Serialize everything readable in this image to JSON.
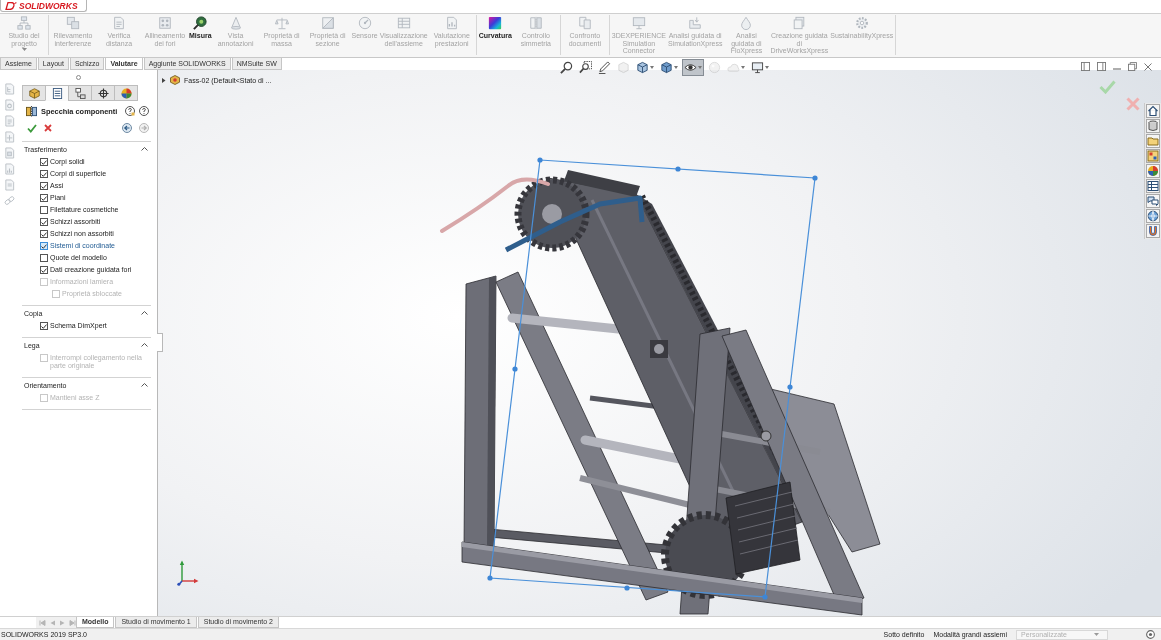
{
  "logo": {
    "text": "SOLIDWORKS"
  },
  "ribbon": {
    "groups": [
      {
        "buttons": [
          {
            "label": "Studio del progetto",
            "kind": "dropdown",
            "disabled": true
          }
        ]
      },
      {
        "buttons": [
          {
            "label": "Rilevamento interferenze",
            "kind": "button",
            "disabled": true
          },
          {
            "label": "Verifica distanza",
            "kind": "button",
            "disabled": true
          },
          {
            "label": "Allineamento dei fori",
            "kind": "button",
            "disabled": true
          },
          {
            "label": "Misura",
            "kind": "button",
            "disabled": false
          },
          {
            "label": "Vista annotazioni",
            "kind": "button",
            "disabled": true
          },
          {
            "label": "Proprietà di massa",
            "kind": "button",
            "disabled": true
          },
          {
            "label": "Proprietà di sezione",
            "kind": "button",
            "disabled": true
          },
          {
            "label": "Sensore",
            "kind": "button",
            "disabled": true
          },
          {
            "label": "Visualizzazione dell'assieme",
            "kind": "button",
            "disabled": true
          },
          {
            "label": "Valutazione prestazioni",
            "kind": "button",
            "disabled": true
          }
        ]
      },
      {
        "buttons": [
          {
            "label": "Curvatura",
            "kind": "button",
            "disabled": false
          },
          {
            "label": "Controllo simmetria",
            "kind": "button",
            "disabled": true
          }
        ]
      },
      {
        "buttons": [
          {
            "label": "Confronto documenti",
            "kind": "button",
            "disabled": true
          }
        ]
      },
      {
        "buttons": [
          {
            "label": "3DEXPERIENCE Simulation Connector",
            "kind": "button",
            "disabled": true
          },
          {
            "label": "Analisi guidata di SimulationXpress",
            "kind": "button",
            "disabled": true
          },
          {
            "label": "Analisi guidata di FloXpress",
            "kind": "button",
            "disabled": true
          },
          {
            "label": "Creazione guidata di DriveWorksXpress",
            "kind": "button",
            "disabled": true
          },
          {
            "label": "SustainabilityXpress",
            "kind": "button",
            "disabled": true
          }
        ]
      }
    ]
  },
  "command_tabs": [
    {
      "label": "Assieme",
      "selected": false
    },
    {
      "label": "Layout",
      "selected": false
    },
    {
      "label": "Schizzo",
      "selected": false
    },
    {
      "label": "Valutare",
      "selected": true
    },
    {
      "label": "Aggiunte SOLIDWORKS",
      "selected": false
    },
    {
      "label": "NMSuite SW",
      "selected": false
    }
  ],
  "property_manager": {
    "tabs": [
      {
        "selected": false
      },
      {
        "selected": true
      },
      {
        "selected": false
      },
      {
        "selected": false
      },
      {
        "selected": false
      }
    ],
    "title": "Specchia componenti",
    "sections": [
      {
        "title": "Trasferimento",
        "expanded": true,
        "options": [
          {
            "label": "Corpi solidi",
            "checked": true,
            "disabled": false,
            "highlighted": false
          },
          {
            "label": "Corpi di superficie",
            "checked": true,
            "disabled": false,
            "highlighted": false
          },
          {
            "label": "Assi",
            "checked": true,
            "disabled": false,
            "highlighted": false
          },
          {
            "label": "Piani",
            "checked": true,
            "disabled": false,
            "highlighted": false
          },
          {
            "label": "Filettature cosmetiche",
            "checked": false,
            "disabled": false,
            "highlighted": false
          },
          {
            "label": "Schizzi assorbiti",
            "checked": true,
            "disabled": false,
            "highlighted": false
          },
          {
            "label": "Schizzi non assorbiti",
            "checked": true,
            "disabled": false,
            "highlighted": false
          },
          {
            "label": "Sistemi di coordinate",
            "checked": true,
            "disabled": false,
            "highlighted": true
          },
          {
            "label": "Quote del modello",
            "checked": false,
            "disabled": false,
            "highlighted": false
          },
          {
            "label": "Dati creazione guidata fori",
            "checked": true,
            "disabled": false,
            "highlighted": false
          },
          {
            "label": "Informazioni lamiera",
            "checked": false,
            "disabled": true,
            "highlighted": false,
            "children": [
              {
                "label": "Proprietà sbloccate",
                "checked": false,
                "disabled": true,
                "highlighted": false
              }
            ]
          }
        ]
      },
      {
        "title": "Copia",
        "expanded": true,
        "options": [
          {
            "label": "Schema DimXpert",
            "checked": true,
            "disabled": false,
            "highlighted": false
          }
        ]
      },
      {
        "title": "Lega",
        "expanded": true,
        "options": [
          {
            "label": "Interrompi collegamento nella parte originale",
            "checked": false,
            "disabled": true,
            "highlighted": false
          }
        ]
      },
      {
        "title": "Orientamento",
        "expanded": true,
        "options": [
          {
            "label": "Mantieni asse Z",
            "checked": false,
            "disabled": true,
            "highlighted": false
          }
        ]
      }
    ]
  },
  "viewport": {
    "tree": {
      "label": "Fass-02 (Default<Stato di ...",
      "expanded": false
    },
    "view_toolbar": [
      {
        "selected": false,
        "disabled": false,
        "menu": false
      },
      {
        "selected": false,
        "disabled": false,
        "menu": false
      },
      {
        "selected": false,
        "disabled": false,
        "menu": false
      },
      {
        "selected": false,
        "disabled": true,
        "menu": false
      },
      {
        "selected": false,
        "disabled": false,
        "menu": true
      },
      {
        "selected": false,
        "disabled": false,
        "menu": true
      },
      {
        "selected": true,
        "disabled": false,
        "menu": true
      },
      {
        "selected": false,
        "disabled": true,
        "menu": false
      },
      {
        "selected": false,
        "disabled": true,
        "menu": true
      },
      {
        "selected": false,
        "disabled": false,
        "menu": true
      }
    ]
  },
  "bottom_tabs": [
    {
      "label": "Modello",
      "selected": true
    },
    {
      "label": "Studio di movimento 1",
      "selected": false
    },
    {
      "label": "Studio di movimento 2",
      "selected": false
    }
  ],
  "status_bar": {
    "version": "SOLIDWORKS 2019 SP3.0",
    "items": [
      "Sotto definito",
      "Modalità grandi assiemi"
    ],
    "configuration": {
      "label": "Personalizzate",
      "disabled": true
    }
  }
}
